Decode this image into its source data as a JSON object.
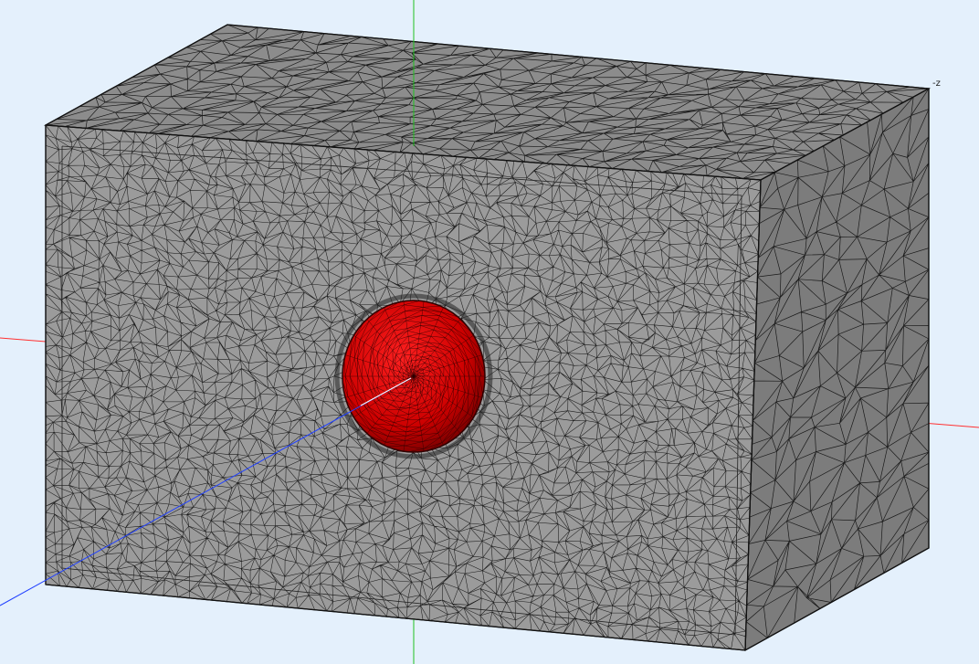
{
  "viewport": {
    "background": "#e4f0fc",
    "axis_label_z": "-z",
    "axes": {
      "x_color": "#ff3030",
      "y_color": "#20c020",
      "z_color": "#2040ff"
    },
    "box": {
      "front_color": "#9b9b9b",
      "top_color": "#8c8c8c",
      "side_color": "#7c7c7c",
      "edge_color": "#111111"
    },
    "sphere": {
      "color": "#e00000",
      "dark_color": "#7a0000"
    }
  }
}
